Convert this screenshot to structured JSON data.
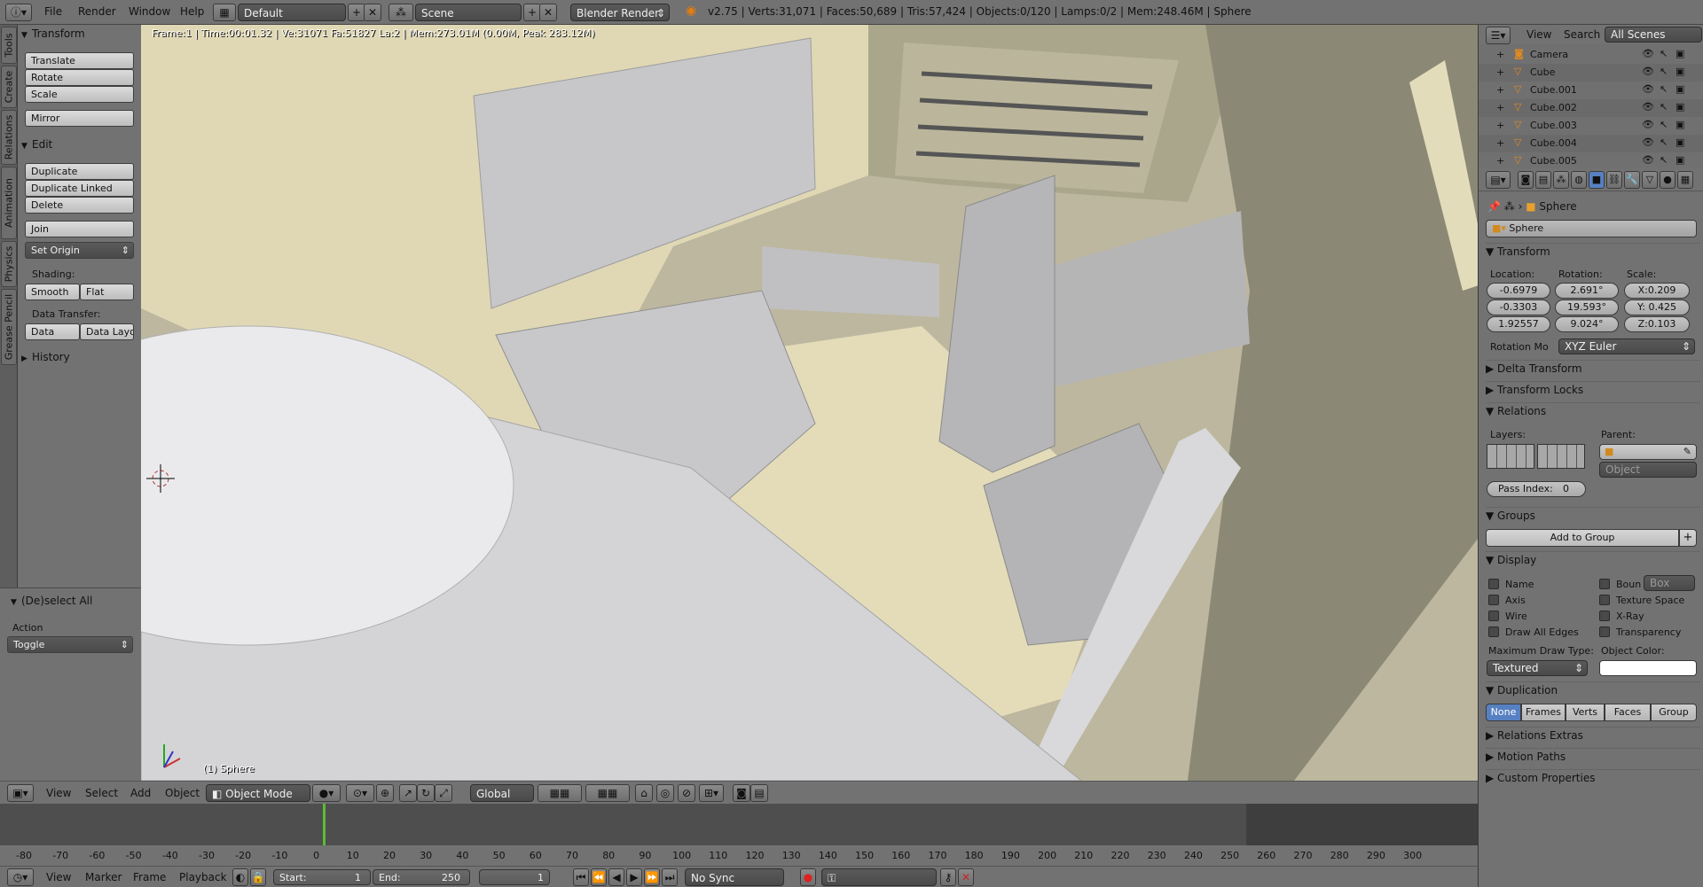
{
  "topbar": {
    "menus": [
      "File",
      "Render",
      "Window",
      "Help"
    ],
    "screen_layout": "Default",
    "scene": "Scene",
    "render_engine": "Blender Render",
    "stats": "v2.75 | Verts:31,071 | Faces:50,689 | Tris:57,424 | Objects:0/120 | Lamps:0/2 | Mem:248.46M | Sphere"
  },
  "shelf": {
    "tabs": [
      "Tools",
      "Create",
      "Relations",
      "Animation",
      "Physics",
      "Grease Pencil"
    ],
    "transform_header": "Transform",
    "transform_buttons": [
      "Translate",
      "Rotate",
      "Scale"
    ],
    "mirror": "Mirror",
    "edit_header": "Edit",
    "edit_buttons": [
      "Duplicate",
      "Duplicate Linked",
      "Delete"
    ],
    "join": "Join",
    "set_origin": "Set Origin",
    "shading_label": "Shading:",
    "smooth": "Smooth",
    "flat": "Flat",
    "data_transfer_label": "Data Transfer:",
    "data": "Data",
    "data_layout": "Data Layo",
    "history": "History"
  },
  "operator": {
    "title": "(De)select All",
    "action_label": "Action",
    "action_value": "Toggle"
  },
  "viewport": {
    "info": "Frame:1 | Time:00:01.32 | Ve:31071 Fa:51827 La:2 | Mem:273.01M (0.00M, Peak 283.12M)",
    "object_name": "(1) Sphere"
  },
  "view3d_header": {
    "menus": [
      "View",
      "Select",
      "Add",
      "Object"
    ],
    "mode": "Object Mode",
    "orientation": "Global"
  },
  "timeline": {
    "ticks": [
      "-80",
      "-70",
      "-60",
      "-50",
      "-40",
      "-30",
      "-20",
      "-10",
      "0",
      "10",
      "20",
      "30",
      "40",
      "50",
      "60",
      "70",
      "80",
      "90",
      "100",
      "110",
      "120",
      "130",
      "140",
      "150",
      "160",
      "170",
      "180",
      "190",
      "200",
      "210",
      "220",
      "230",
      "240",
      "250",
      "260",
      "270",
      "280",
      "290",
      "300"
    ],
    "menus": [
      "View",
      "Marker",
      "Frame",
      "Playback"
    ],
    "start_label": "Start:",
    "start_value": "1",
    "end_label": "End:",
    "end_value": "250",
    "current_frame": "1",
    "sync": "No Sync"
  },
  "outliner": {
    "menus": [
      "View",
      "Search"
    ],
    "filter": "All Scenes",
    "items": [
      "Camera",
      "Cube",
      "Cube.001",
      "Cube.002",
      "Cube.003",
      "Cube.004",
      "Cube.005"
    ]
  },
  "properties": {
    "breadcrumb": "Sphere",
    "object_name": "Sphere",
    "transform_header": "Transform",
    "location_label": "Location:",
    "rotation_label": "Rotation:",
    "scale_label": "Scale:",
    "location": [
      "-0.6979",
      "-0.3303",
      "1.92557"
    ],
    "rotation": [
      "2.691°",
      "19.593°",
      "9.024°"
    ],
    "scale": [
      "X:0.209",
      "Y: 0.425",
      "Z:0.103"
    ],
    "rotation_mode_label": "Rotation Mo",
    "rotation_mode": "XYZ Euler",
    "delta_transform": "Delta Transform",
    "transform_locks": "Transform Locks",
    "relations": "Relations",
    "layers_label": "Layers:",
    "parent_label": "Parent:",
    "parent_type": "Object",
    "pass_index_label": "Pass Index:",
    "pass_index": "0",
    "groups": "Groups",
    "add_to_group": "Add to Group",
    "display": "Display",
    "display_options_left": [
      "Name",
      "Axis",
      "Wire",
      "Draw All Edges"
    ],
    "display_options_right": [
      "Boun",
      "Texture Space",
      "X-Ray",
      "Transparency"
    ],
    "bounds_type": "Box",
    "max_draw_type_label": "Maximum Draw Type:",
    "max_draw_type": "Textured",
    "object_color_label": "Object Color:",
    "duplication": "Duplication",
    "duplication_modes": [
      "None",
      "Frames",
      "Verts",
      "Faces",
      "Group"
    ],
    "relations_extras": "Relations Extras",
    "motion_paths": "Motion Paths",
    "custom_properties": "Custom Properties"
  }
}
